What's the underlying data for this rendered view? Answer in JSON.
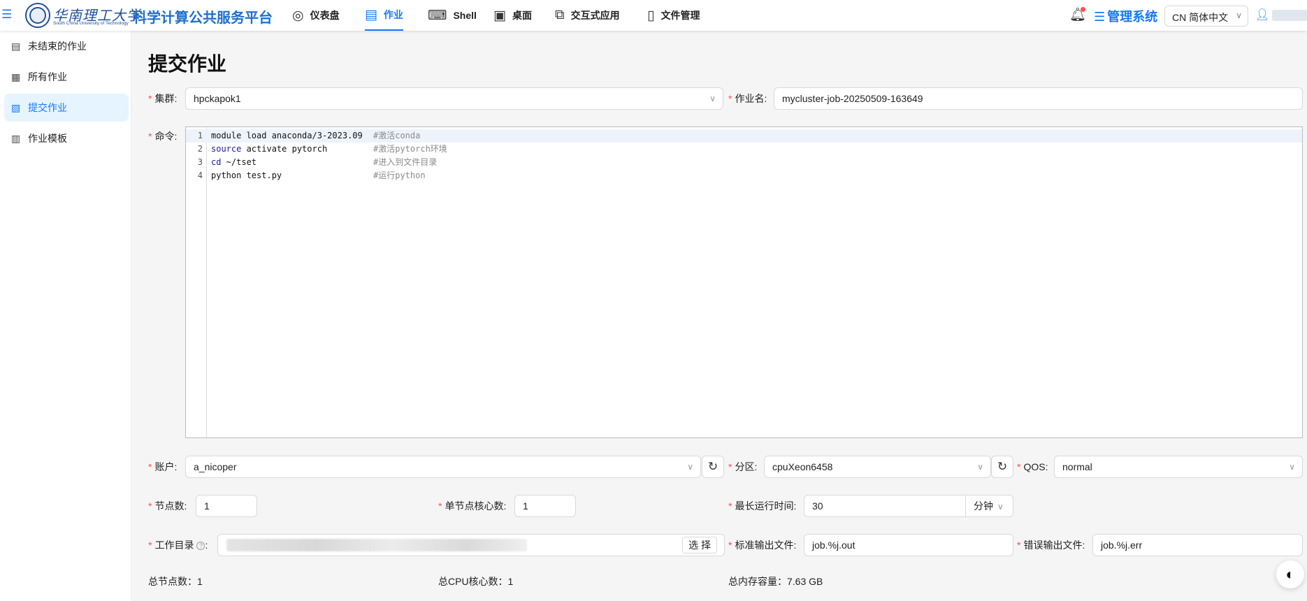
{
  "header": {
    "university_name": "华南理工大学",
    "university_en": "South China University of Technology",
    "platform_name": "科学计算公共服务平台",
    "nav": [
      {
        "label": "仪表盘",
        "icon": "dashboard-icon"
      },
      {
        "label": "作业",
        "icon": "job-icon",
        "active": true
      },
      {
        "label": "Shell",
        "icon": "terminal-icon"
      },
      {
        "label": "桌面",
        "icon": "desktop-icon"
      },
      {
        "label": "交互式应用",
        "icon": "apps-icon"
      },
      {
        "label": "文件管理",
        "icon": "file-icon"
      }
    ],
    "admin_label": "管理系统",
    "language": "CN 简体中文"
  },
  "sidebar": {
    "items": [
      {
        "label": "未结束的作业"
      },
      {
        "label": "所有作业"
      },
      {
        "label": "提交作业",
        "active": true
      },
      {
        "label": "作业模板"
      }
    ]
  },
  "page": {
    "title": "提交作业"
  },
  "form": {
    "cluster_label": "集群",
    "cluster_value": "hpckapok1",
    "job_name_label": "作业名",
    "job_name_value": "mycluster-job-20250509-163649",
    "command_label": "命令",
    "code_lines": [
      {
        "num": "1",
        "pre": "module load anaconda/3-2023.09",
        "comment": "#激活conda"
      },
      {
        "num": "2",
        "kw": "source",
        "rest": " activate pytorch",
        "comment": "#激活pytorch环境"
      },
      {
        "num": "3",
        "kw": "cd",
        "rest": " ~/tset",
        "comment": "#进入到文件目录"
      },
      {
        "num": "4",
        "pre": "python test.py",
        "comment": "#运行python"
      }
    ],
    "account_label": "账户",
    "account_value": "a_nicoper",
    "partition_label": "分区",
    "partition_value": "cpuXeon6458",
    "qos_label": "QOS",
    "qos_value": "normal",
    "nodes_label": "节点数",
    "nodes_value": "1",
    "cores_label": "单节点核心数",
    "cores_value": "1",
    "max_time_label": "最长运行时间",
    "max_time_value": "30",
    "max_time_unit": "分钟",
    "workdir_label": "工作目录",
    "select_button": "选 择",
    "stdout_label": "标准输出文件",
    "stdout_value": "job.%j.out",
    "stderr_label": "错误输出文件",
    "stderr_value": "job.%j.err"
  },
  "summary": {
    "total_nodes": "总节点数：1",
    "total_cpu": "总CPU核心数：1",
    "total_memory": "总内存容量：7.63 GB"
  }
}
